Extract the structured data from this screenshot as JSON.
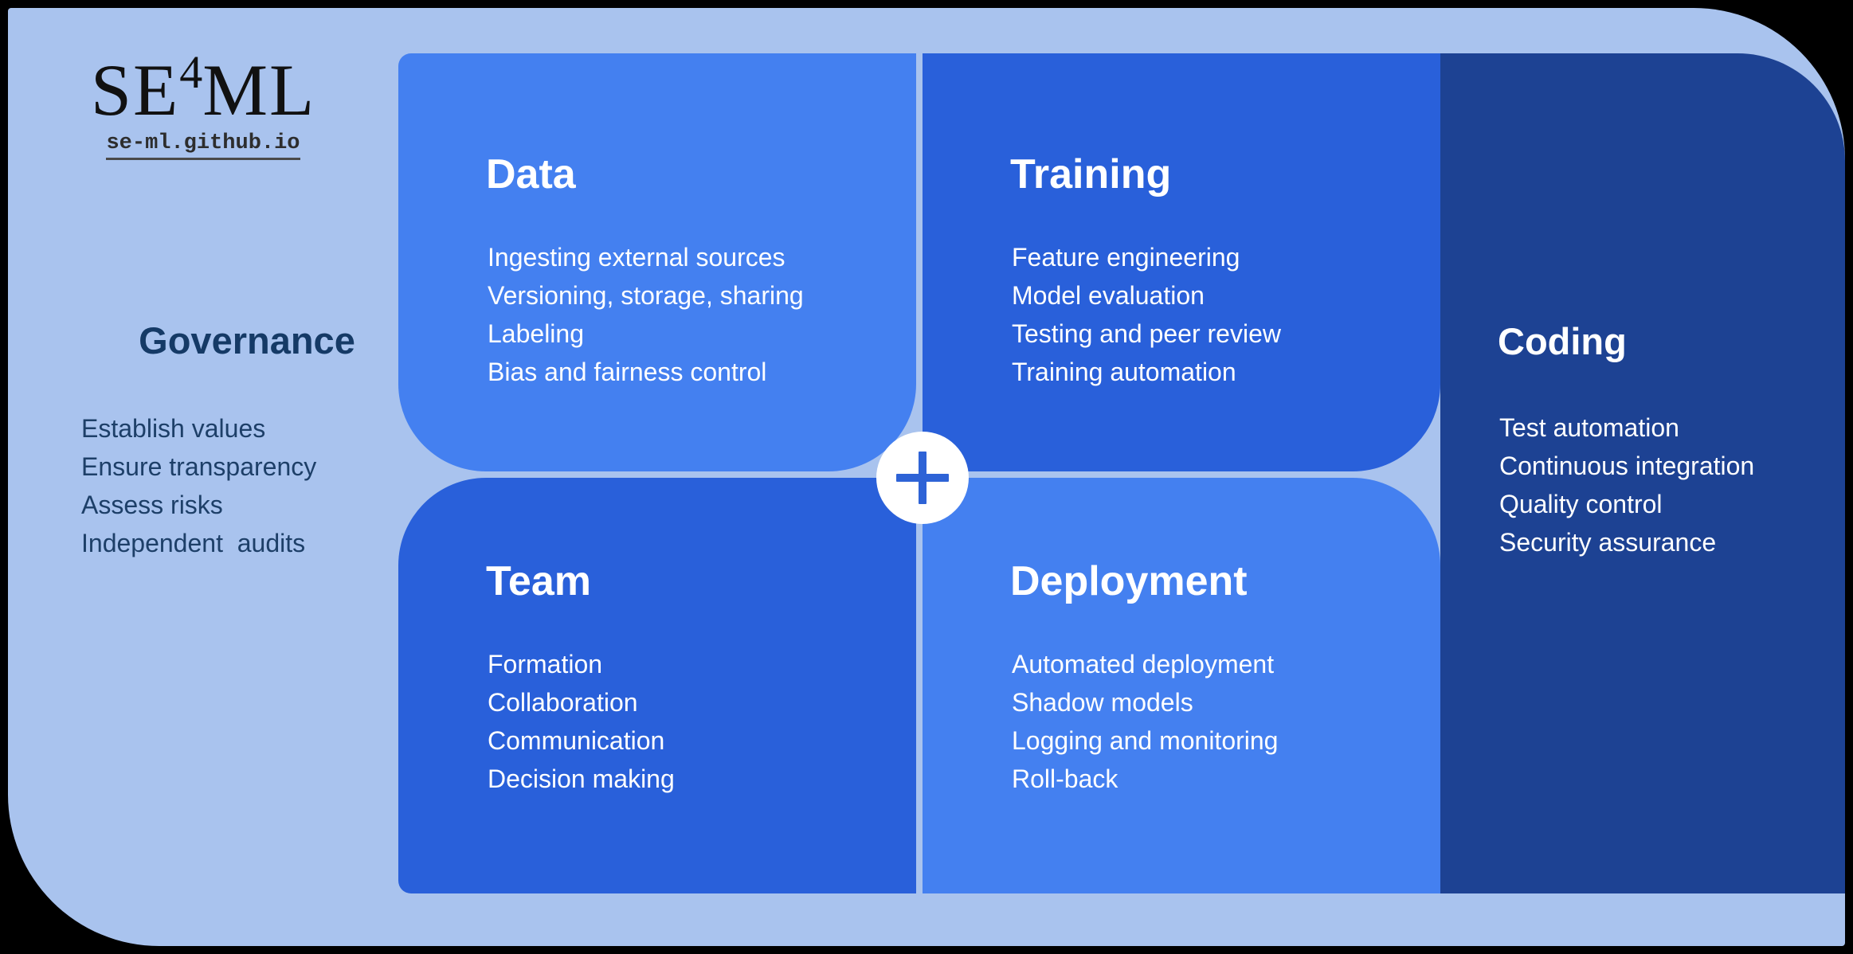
{
  "brand": {
    "logo_text": "SE",
    "logo_superscript": "4",
    "logo_text2": "ML",
    "url": "se-ml.github.io"
  },
  "colors": {
    "page_background": "#000000",
    "frame": "#a9c3ee",
    "light_blue": "#4480f0",
    "medium_blue": "#2960da",
    "dark_navy": "#1d4293",
    "governance_text": "#1d3f68",
    "plus_accent": "#2e63d6",
    "panel_text": "#ffffff"
  },
  "governance": {
    "title": "Governance",
    "items_text": "Establish values\nEnsure transparency\nAssess risks\nIndependent  audits",
    "items": [
      "Establish values",
      "Ensure transparency",
      "Assess risks",
      "Independent  audits"
    ]
  },
  "quadrants": {
    "data": {
      "title": "Data",
      "items_text": "Ingesting external sources\nVersioning, storage, sharing\nLabeling\nBias and fairness control",
      "items": [
        "Ingesting external sources",
        "Versioning, storage, sharing",
        "Labeling",
        "Bias and fairness control"
      ]
    },
    "training": {
      "title": "Training",
      "items_text": "Feature engineering\nModel evaluation\nTesting and peer review\nTraining automation",
      "items": [
        "Feature engineering",
        "Model evaluation",
        "Testing and peer review",
        "Training automation"
      ]
    },
    "team": {
      "title": "Team",
      "items_text": "Formation\nCollaboration\nCommunication\nDecision making",
      "items": [
        "Formation",
        "Collaboration",
        "Communication",
        "Decision making"
      ]
    },
    "deployment": {
      "title": "Deployment",
      "items_text": "Automated deployment\nShadow models\nLogging and monitoring\nRoll-back",
      "items": [
        "Automated deployment",
        "Shadow models",
        "Logging and monitoring",
        "Roll-back"
      ]
    }
  },
  "coding": {
    "title": "Coding",
    "items_text": "Test automation\nContinuous integration\nQuality control\nSecurity assurance",
    "items": [
      "Test automation",
      "Continuous integration",
      "Quality control",
      "Security assurance"
    ]
  },
  "center": {
    "icon": "plus-icon",
    "symbol": "+"
  }
}
